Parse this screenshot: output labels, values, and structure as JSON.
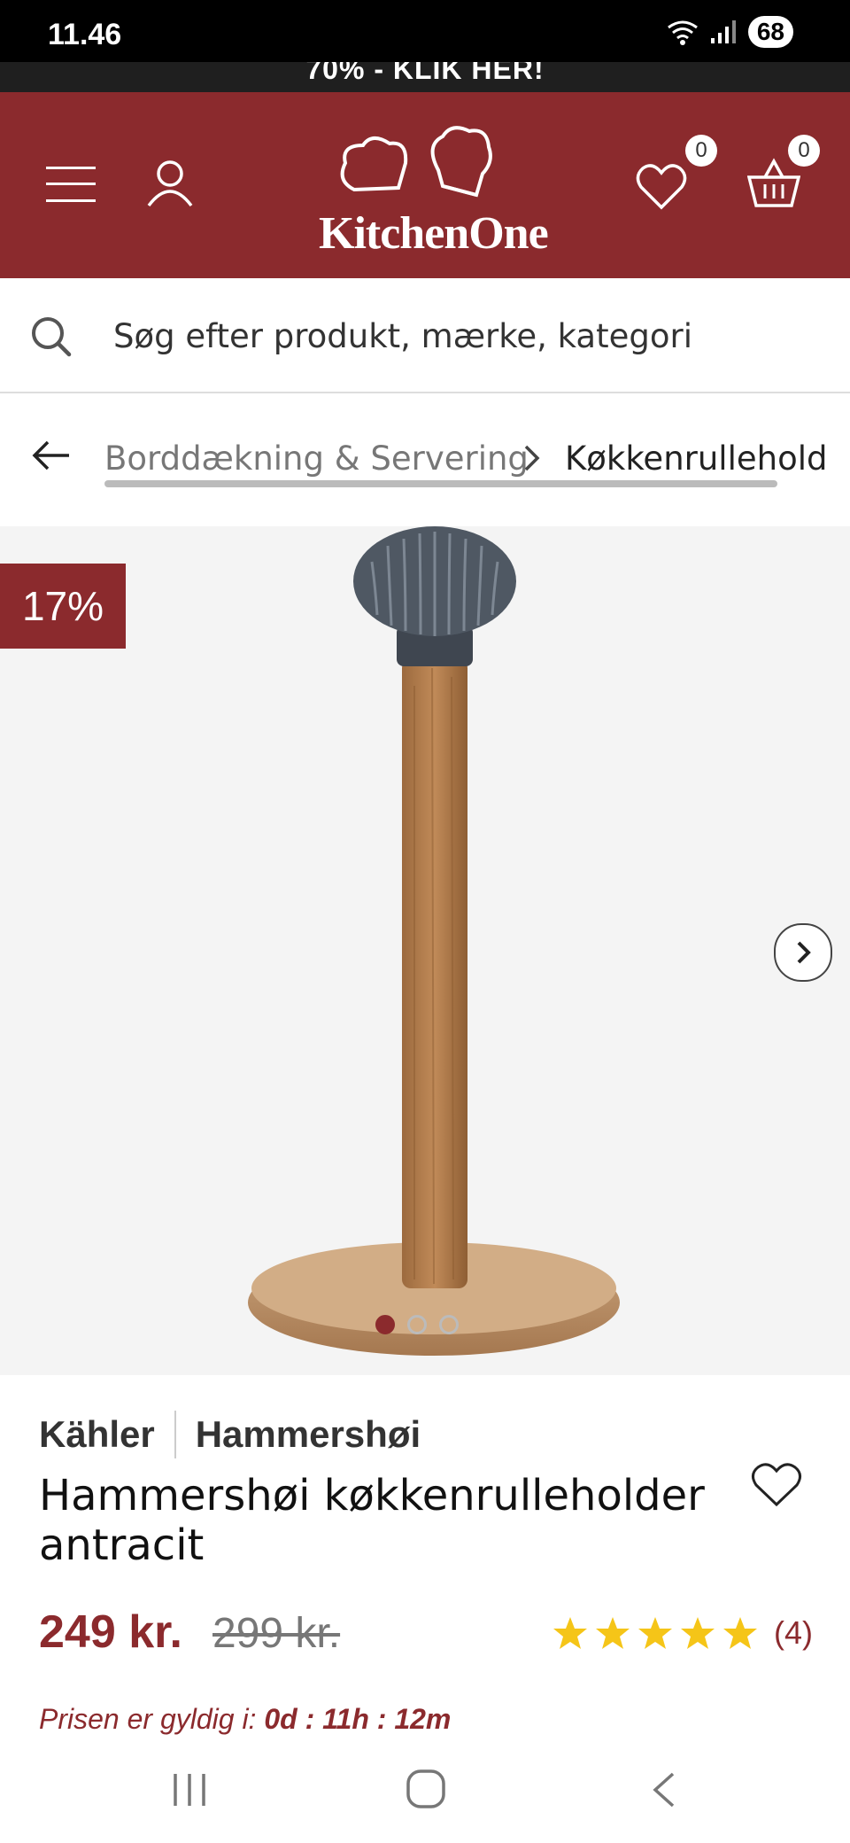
{
  "status_bar": {
    "time": "11.46",
    "battery": "68"
  },
  "promo": {
    "text": "70% - KLIK HER!"
  },
  "header": {
    "brand": "KitchenOne",
    "wishlist_count": "0",
    "cart_count": "0"
  },
  "search": {
    "placeholder": "Søg efter produkt, mærke, kategori"
  },
  "breadcrumb": {
    "items": [
      "Borddækning & Servering",
      "Køkkenrullehold"
    ]
  },
  "gallery": {
    "discount_badge": "17%",
    "slide_count": 3,
    "active_slide": 1
  },
  "product": {
    "brand": "Kähler",
    "series": "Hammershøi",
    "title": "Hammershøi køkkenrulleholder antracit",
    "price": "249 kr.",
    "old_price": "299 kr.",
    "rating": 5,
    "review_count": "(4)",
    "validity_label": "Prisen er gyldig i:",
    "validity_time": "0d : 11h : 12m"
  },
  "colors": {
    "brand_red": "#8b2a2d",
    "star": "#f5c518"
  }
}
